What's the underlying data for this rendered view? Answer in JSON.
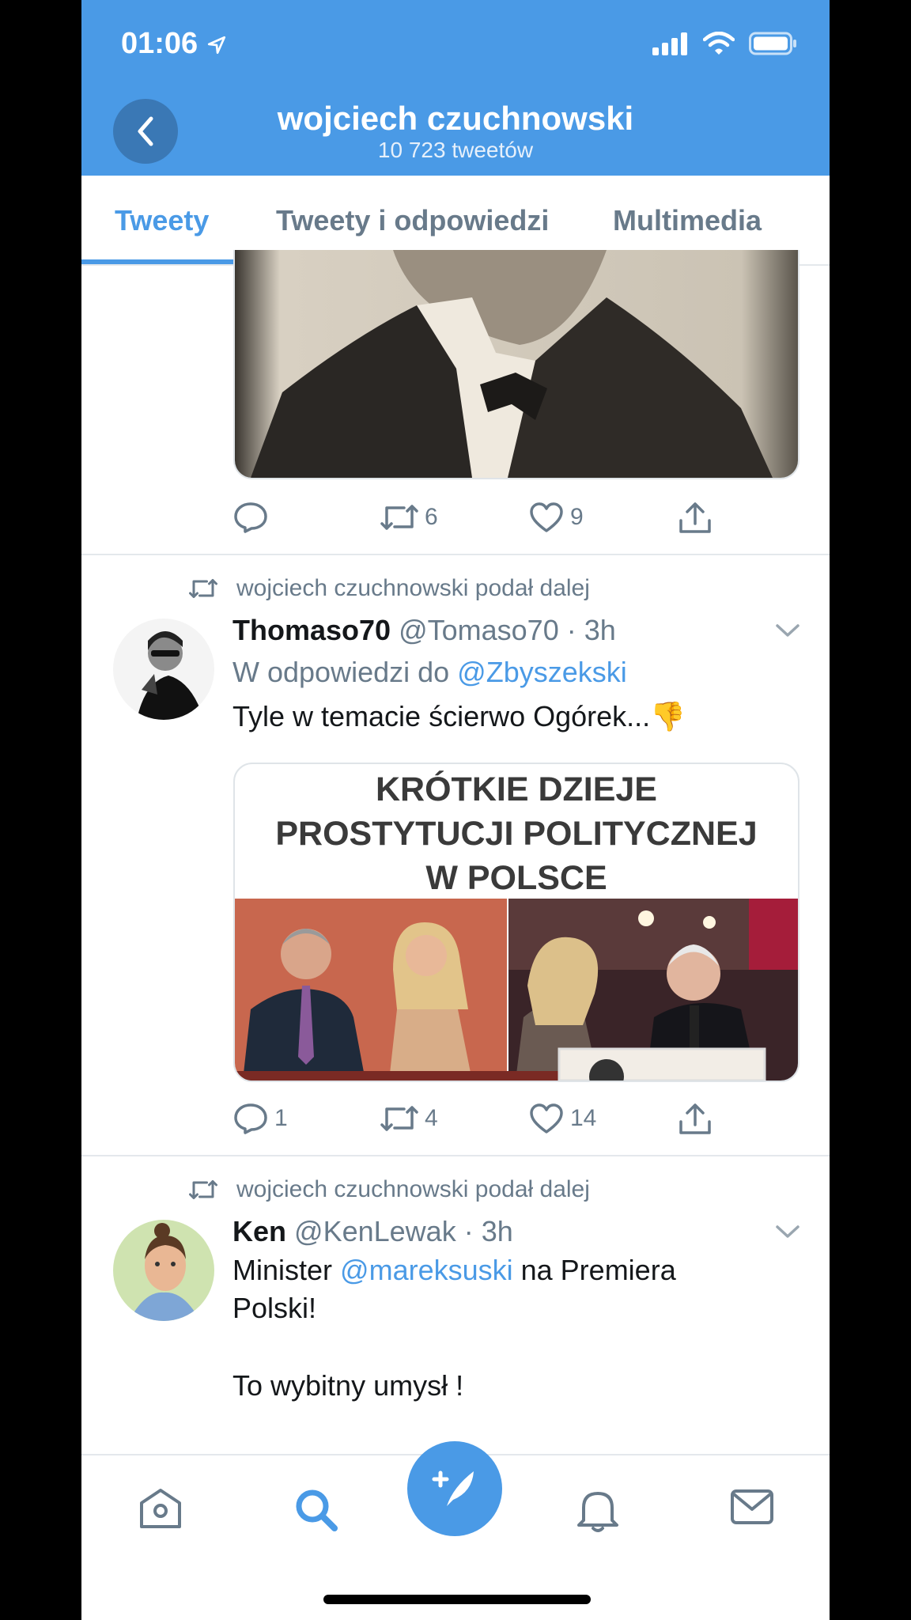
{
  "status": {
    "time": "01:06"
  },
  "header": {
    "title": "wojciech czuchnowski",
    "subtitle": "10 723 tweetów"
  },
  "tabs": [
    {
      "label": "Tweety"
    },
    {
      "label": "Tweety i odpowiedzi"
    },
    {
      "label": "Multimedia"
    }
  ],
  "tweet0": {
    "actions": {
      "replies": "",
      "retweets": "6",
      "likes": "9"
    }
  },
  "tweet1": {
    "retweeted_by": "wojciech czuchnowski podał dalej",
    "name": "Thomaso70",
    "handle": "@Tomaso70",
    "time": "· 3h",
    "reply_prefix": "W odpowiedzi do ",
    "reply_to": "@Zbyszekski",
    "text": "Tyle w temacie ścierwo Ogórek...",
    "emoji": "👎",
    "image_headline": [
      "KRÓTKIE DZIEJE",
      "PROSTYTUCJI POLITYCZNEJ",
      "W POLSCE"
    ],
    "actions": {
      "replies": "1",
      "retweets": "4",
      "likes": "14"
    }
  },
  "tweet2": {
    "retweeted_by": "wojciech czuchnowski podał dalej",
    "name": "Ken",
    "handle": "@KenLewak",
    "time": "· 3h",
    "text_prefix": "Minister ",
    "mention": "@mareksuski",
    "text_suffix": " na Premiera",
    "text_line2": "Polski!",
    "text_line3": "To wybitny umysł !"
  },
  "colors": {
    "accent": "#4a9ae6",
    "muted": "#687a8a",
    "text": "#14171a"
  },
  "icons": [
    "back-arrow-icon",
    "reply-icon",
    "retweet-icon",
    "like-icon",
    "share-icon",
    "chevron-down-icon",
    "home-icon",
    "search-icon",
    "compose-icon",
    "notifications-icon",
    "messages-icon"
  ]
}
